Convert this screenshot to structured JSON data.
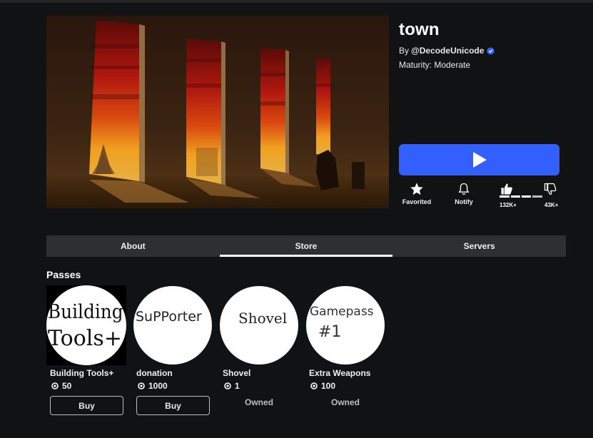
{
  "game": {
    "title": "town",
    "by_prefix": "By",
    "creator": "@DecodeUnicode",
    "maturity": "Maturity: Moderate"
  },
  "actions": {
    "favorite": "Favorited",
    "notify": "Notify",
    "upvotes": "132K+",
    "downvotes": "43K+",
    "like_ratio": 0.75
  },
  "tabs": [
    {
      "label": "About"
    },
    {
      "label": "Store",
      "active": true
    },
    {
      "label": "Servers"
    }
  ],
  "store": {
    "section_title": "Passes",
    "passes": [
      {
        "name": "Building Tools+",
        "price": "50",
        "action": "Buy",
        "icon_text": [
          "Building",
          "Tools+"
        ]
      },
      {
        "name": "donation",
        "price": "1000",
        "action": "Buy",
        "icon_text": [
          "SuPPorter"
        ]
      },
      {
        "name": "Shovel",
        "price": "1",
        "action": "Owned",
        "icon_text": [
          "Shovel"
        ]
      },
      {
        "name": "Extra Weapons",
        "price": "100",
        "action": "Owned",
        "icon_text": [
          "Gamepass",
          "#1"
        ]
      }
    ]
  },
  "colors": {
    "background": "#111214",
    "play_button": "#335fff",
    "tab_bar": "#2d2f31",
    "verified": "#335fff"
  }
}
